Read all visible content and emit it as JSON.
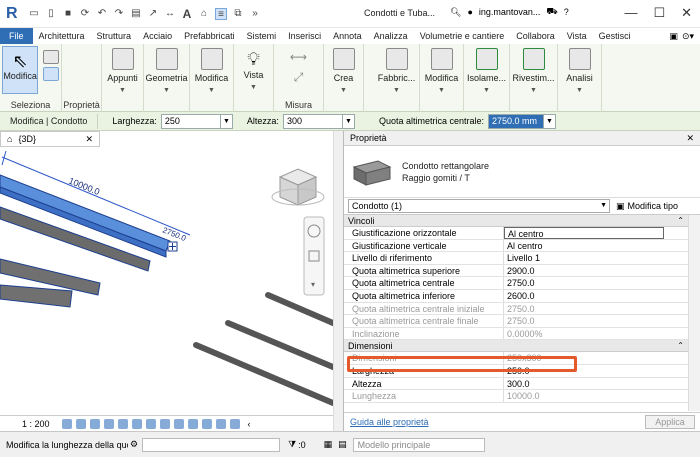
{
  "titlebar": {
    "logo": "R",
    "doc_title": "Condotti e Tuba...",
    "user": "ing.mantovan...",
    "help": "?"
  },
  "tabs": [
    "File",
    "Architettura",
    "Struttura",
    "Acciaio",
    "Prefabbricati",
    "Sistemi",
    "Inserisci",
    "Annota",
    "Analizza",
    "Volumetrie e cantiere",
    "Collabora",
    "Vista",
    "Gestisci"
  ],
  "active_tab": "Modifica | Condotto",
  "ribbon": {
    "modifica": "Modifica",
    "seleziona": "Seleziona",
    "proprieta": "Proprietà",
    "appunti": "Appunti",
    "geometria": "Geometria",
    "modifica2": "Modifica",
    "vista": "Vista",
    "misura": "Misura",
    "crea": "Crea",
    "fabbric": "Fabbric...",
    "modifica3": "Modifica",
    "isolame": "Isolame...",
    "rivestim": "Rivestim...",
    "analisi": "Analisi"
  },
  "ctx": {
    "label": "Modifica | Condotto",
    "larghezza_label": "Larghezza:",
    "larghezza": "250",
    "altezza_label": "Altezza:",
    "altezza": "300",
    "quota_label": "Quota altimetrica centrale:",
    "quota": "2750.0 mm"
  },
  "view": {
    "tab": "{3D}",
    "dim1": "10000.0",
    "dim2": "2750.0",
    "scale": "1 : 200"
  },
  "props": {
    "title": "Proprietà",
    "type_line1": "Condotto rettangolare",
    "type_line2": "Raggio gomiti / T",
    "selector": "Condotto (1)",
    "edit_type": "Modifica tipo",
    "sections": [
      {
        "name": "Vincoli",
        "rows": [
          {
            "k": "Giustificazione orizzontale",
            "v": "Al centro"
          },
          {
            "k": "Giustificazione verticale",
            "v": "Al centro"
          },
          {
            "k": "Livello di riferimento",
            "v": "Livello 1"
          },
          {
            "k": "Quota altimetrica superiore",
            "v": "2900.0"
          },
          {
            "k": "Quota altimetrica centrale",
            "v": "2750.0"
          },
          {
            "k": "Quota altimetrica inferiore",
            "v": "2600.0"
          },
          {
            "k": "Quota altimetrica centrale iniziale",
            "v": "2750.0"
          },
          {
            "k": "Quota altimetrica centrale finale",
            "v": "2750.0"
          },
          {
            "k": "Inclinazione",
            "v": "0.0000%"
          }
        ]
      },
      {
        "name": "Dimensioni",
        "rows": [
          {
            "k": "Dimensioni",
            "v": "250x300"
          },
          {
            "k": "Larghezza",
            "v": "250.0"
          },
          {
            "k": "Altezza",
            "v": "300.0"
          },
          {
            "k": "Lunghezza",
            "v": "10000.0"
          }
        ]
      }
    ],
    "help_link": "Guida alle proprietà",
    "apply": "Applica"
  },
  "status": {
    "message": "Modifica la lunghezza della quo",
    "zero": ":0",
    "model": "Modello principale"
  },
  "colors": {
    "accent": "#2f6db5",
    "highlight": "#e45a2a",
    "duct_selected": "#5a8fdc"
  }
}
